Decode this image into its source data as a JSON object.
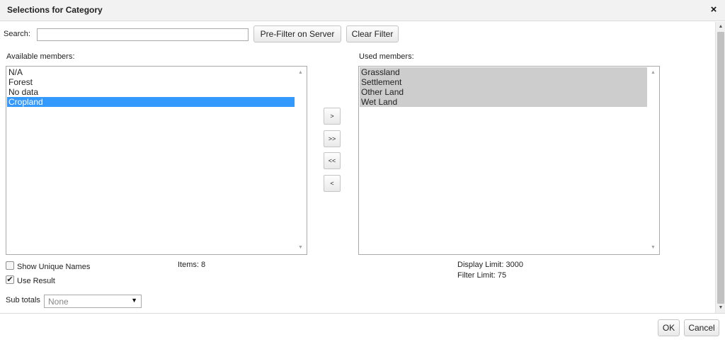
{
  "dialog": {
    "title": "Selections for Category",
    "close_glyph": "×"
  },
  "search": {
    "label": "Search:",
    "value": "",
    "placeholder": ""
  },
  "buttons": {
    "prefilter": "Pre-Filter on Server",
    "clear_filter": "Clear Filter",
    "add_selected": ">",
    "add_all": ">>",
    "remove_all": "<<",
    "remove_selected": "<",
    "ok": "OK",
    "cancel": "Cancel"
  },
  "available": {
    "label": "Available members:",
    "items": [
      "N/A",
      "Forest",
      "No data",
      "Cropland"
    ],
    "selected_index": 3,
    "count_text": "Items: 8"
  },
  "used": {
    "label": "Used members:",
    "items": [
      "Grassland",
      "Settlement",
      "Other Land",
      "Wet Land"
    ],
    "display_limit": "Display Limit: 3000",
    "filter_limit": "Filter Limit: 75"
  },
  "options": {
    "show_unique_names": {
      "label": "Show Unique Names",
      "checked": false
    },
    "use_result": {
      "label": "Use Result",
      "checked": true,
      "check_glyph": "✔"
    }
  },
  "subtotals": {
    "label": "Sub totals",
    "selected": "None"
  },
  "icons": {
    "scroll_up": "▲",
    "scroll_down": "▼",
    "dropdown": "▼"
  },
  "colors": {
    "selection": "#3399ff",
    "used_item_bg": "#cdcdcd"
  }
}
